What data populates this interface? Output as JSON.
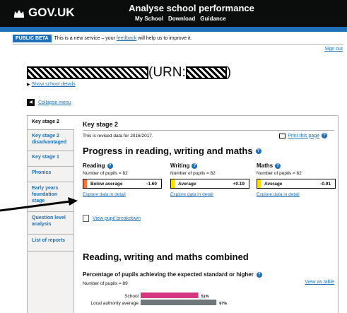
{
  "header": {
    "logo_text": "GOV.UK",
    "service_name": "Analyse school performance",
    "nav": [
      "My School",
      "Download",
      "Guidance"
    ]
  },
  "beta": {
    "tag": "PUBLIC BETA",
    "text_before": "This is a new service – your ",
    "link": "feedback",
    "text_after": " will help us to improve it."
  },
  "signout": "Sign out",
  "school": {
    "urn_label": "(URN:",
    "close": ")",
    "show_details": "Show school details"
  },
  "collapse_menu": "Collapse menu",
  "sidebar": {
    "items": [
      {
        "label": "Key stage 2"
      },
      {
        "label": "Key stage 2 disadvantaged"
      },
      {
        "label": "Key stage 1"
      },
      {
        "label": "Phonics"
      },
      {
        "label": "Early years foundation stage"
      },
      {
        "label": "Question level analysis"
      },
      {
        "label": "List of reports"
      }
    ]
  },
  "main": {
    "title": "Key stage 2",
    "revised": "This is revised data for 2016/2017.",
    "print": "Print this page",
    "progress_title": "Progress in reading, writing and maths",
    "subjects": [
      {
        "name": "Reading",
        "pupils": "Number of pupils = 82",
        "band": "Below average",
        "score": "-1.60",
        "color": "#f47738",
        "explore": "Explore data in detail"
      },
      {
        "name": "Writing",
        "pupils": "Number of pupils = 82",
        "band": "Average",
        "score": "+0.19",
        "color": "#ffdd00",
        "explore": "Explore data in detail"
      },
      {
        "name": "Maths",
        "pupils": "Number of pupils = 82",
        "band": "Average",
        "score": "-0.91",
        "color": "#ffdd00",
        "explore": "Explore data in detail"
      }
    ],
    "pupil_breakdown": "View pupil breakdown",
    "combined_title": "Reading, writing and maths combined",
    "pct_title": "Percentage of pupils achieving the expected standard or higher",
    "pct_pupils": "Number of pupils = 89",
    "view_table": "View as table",
    "help_mark": "?"
  },
  "chart_data": {
    "type": "bar",
    "categories": [
      "School",
      "Local authority average"
    ],
    "values": [
      51,
      67
    ],
    "data_labels": [
      "51%",
      "67%"
    ],
    "colors": [
      "#d53880",
      "#6f777b"
    ],
    "xlim": [
      0,
      100
    ]
  }
}
